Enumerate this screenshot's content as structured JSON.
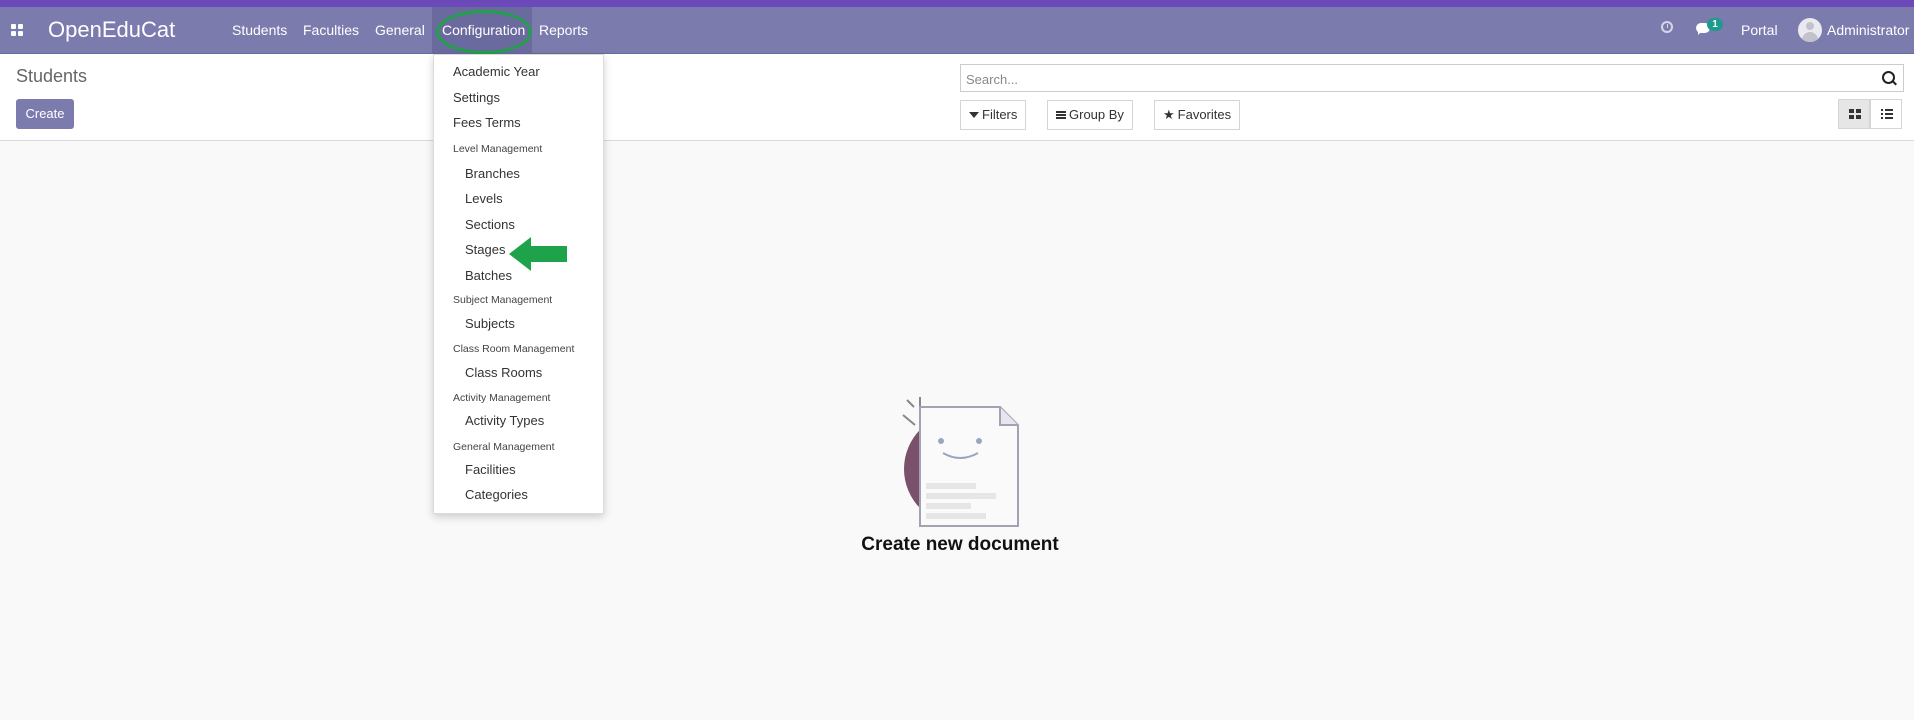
{
  "navbar": {
    "brand": "OpenEduCat",
    "menu": [
      "Students",
      "Faculties",
      "General",
      "Configuration",
      "Reports"
    ],
    "active_menu": "Configuration",
    "chat_badge": "1",
    "portal": "Portal",
    "user": "Administrator"
  },
  "control_panel": {
    "title": "Students",
    "create_label": "Create",
    "search_placeholder": "Search...",
    "filters_label": "Filters",
    "groupby_label": "Group By",
    "favorites_label": "Favorites"
  },
  "dropdown": {
    "items": [
      {
        "type": "item",
        "label": "Academic Year"
      },
      {
        "type": "item",
        "label": "Settings"
      },
      {
        "type": "item",
        "label": "Fees Terms"
      },
      {
        "type": "header",
        "label": "Level Management"
      },
      {
        "type": "sub",
        "label": "Branches"
      },
      {
        "type": "sub",
        "label": "Levels"
      },
      {
        "type": "sub",
        "label": "Sections"
      },
      {
        "type": "sub",
        "label": "Stages"
      },
      {
        "type": "sub",
        "label": "Batches"
      },
      {
        "type": "header",
        "label": "Subject Management"
      },
      {
        "type": "sub",
        "label": "Subjects"
      },
      {
        "type": "header",
        "label": "Class Room Management"
      },
      {
        "type": "sub",
        "label": "Class Rooms"
      },
      {
        "type": "header",
        "label": "Activity Management"
      },
      {
        "type": "sub",
        "label": "Activity Types"
      },
      {
        "type": "header",
        "label": "General Management"
      },
      {
        "type": "sub",
        "label": "Facilities"
      },
      {
        "type": "sub",
        "label": "Categories"
      }
    ]
  },
  "empty_state": {
    "title": "Create new document"
  },
  "colors": {
    "navbar": "#7c7bad",
    "top_strip": "#6c49b8",
    "annotation_green": "#1fa34a",
    "badge": "#1d9b8c"
  },
  "icons": [
    "apps-icon",
    "clock-icon",
    "chat-icon",
    "avatar",
    "search-icon",
    "filter-icon",
    "group-by-icon",
    "star-icon",
    "kanban-view-icon",
    "list-view-icon",
    "arrow-annotation-icon"
  ]
}
